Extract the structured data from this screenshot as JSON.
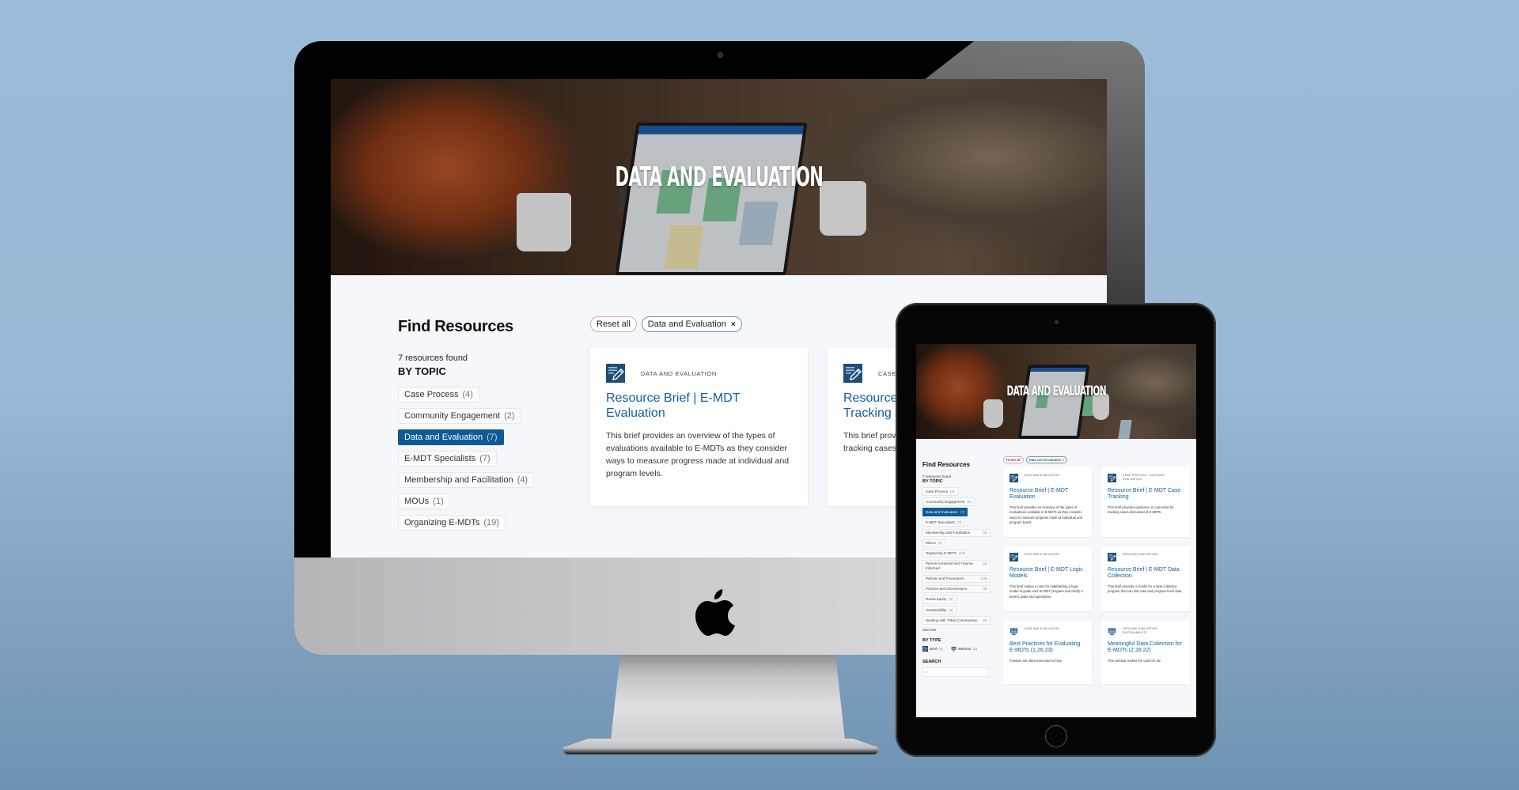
{
  "colors": {
    "accent": "#0e5a96",
    "link": "#13609e",
    "reset_border": "#d9a7ad",
    "tag_border": "#6d97c0",
    "page_bg": "#f5f7fa"
  },
  "hero": {
    "title": "DATA AND EVALUATION"
  },
  "sidebar": {
    "title": "Find Resources",
    "results_count": "7 resources found",
    "by_topic_label": "BY TOPIC",
    "topics": [
      {
        "label": "Case Process",
        "count": "(4)",
        "active": false
      },
      {
        "label": "Community Engagement",
        "count": "(2)",
        "active": false
      },
      {
        "label": "Data and Evaluation",
        "count": "(7)",
        "active": true
      },
      {
        "label": "E-MDT Specialists",
        "count": "(7)",
        "active": false
      },
      {
        "label": "Membership and Facilitation",
        "count": "(4)",
        "active": false
      },
      {
        "label": "MOUs",
        "count": "(1)",
        "active": false
      },
      {
        "label": "Organizing E-MDTs",
        "count": "(19)",
        "active": false
      },
      {
        "label": "Person-Centered and Trauma-Informed",
        "count": "(4)",
        "active": false
      },
      {
        "label": "Policies and Procedures",
        "count": "(10)",
        "active": false
      },
      {
        "label": "Practice and Interventions",
        "count": "(8)",
        "active": false
      },
      {
        "label": "Racial Equity",
        "count": "(2)",
        "active": false
      },
      {
        "label": "Sustainability",
        "count": "(4)",
        "active": false
      },
      {
        "label": "Working with Tribal Communities",
        "count": "(3)",
        "active": false
      }
    ],
    "see_less": "See less",
    "by_type_label": "BY TYPE",
    "types": [
      {
        "label": "Brief",
        "count": "(4)",
        "icon": "document-edit-icon"
      },
      {
        "label": "Webinar",
        "count": "(3)",
        "icon": "webinar-icon"
      }
    ],
    "search_label": "SEARCH",
    "search_placeholder": "",
    "search_icon": "search-icon"
  },
  "filters": {
    "reset_label": "Reset all",
    "active_tag": "Data and Evaluation",
    "remove_icon": "×"
  },
  "cards": [
    {
      "category": "DATA AND EVALUATION",
      "title": "Resource Brief | E-MDT Evaluation",
      "description": "This brief provides an overview of the types of evaluations available to E-MDTs as they consider ways to measure progress made at individual and program levels.",
      "icon": "document-edit-icon"
    },
    {
      "category": "CASE PROCESS · DATA AND EVALUATION",
      "category_visible_desktop": "CASE I",
      "title": "Resource Brief | E-MDT Case Tracking",
      "title_visible_desktop": "Resource\nTracking",
      "description": "This brief provides guidance on a process for tracking cases discussed at E-MDTs.",
      "description_visible_desktop": "This brief prov\ntracking cases",
      "icon": "document-edit-icon"
    },
    {
      "category": "DATA AND EVALUATION",
      "title": "Resource Brief | E-MDT Logic Models",
      "description": "This brief makes a case for establishing a logic model to guide each E-MDT program and clarify a team's goals and operations.",
      "icon": "document-edit-icon"
    },
    {
      "category": "DATA AND EVALUATION",
      "title": "Resource Brief | E-MDT Data Collection",
      "description": "This brief provides a model for a data collection program that can link case and program-level data.",
      "icon": "document-edit-icon"
    },
    {
      "category": "DATA AND EVALUATION",
      "title": "Best Practices for Evaluating E-MDTs (1.26.23)",
      "description": "Funders are often interested in how",
      "icon": "webinar-icon"
    },
    {
      "category": "DATA AND EVALUATION · SUSTAINABILITY",
      "title": "Meaningful Data Collection for E-MDTs (2.28.22)",
      "description": "This webinar makes the case for the",
      "icon": "webinar-icon"
    }
  ]
}
